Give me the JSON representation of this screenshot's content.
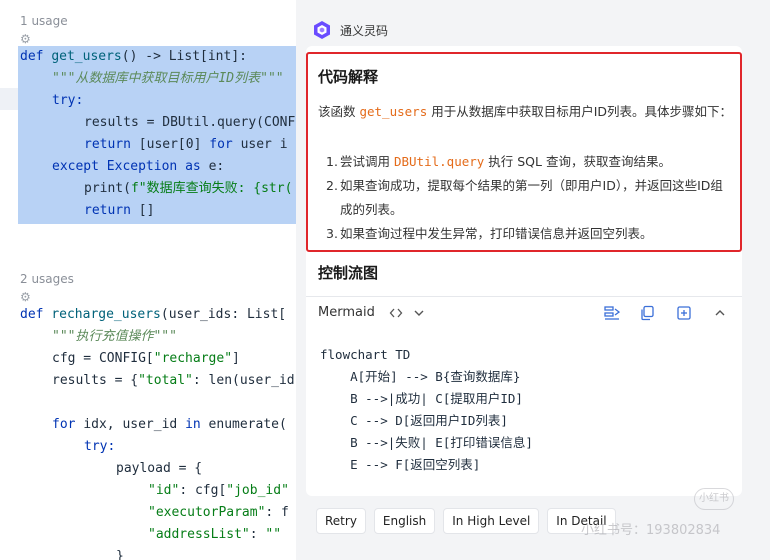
{
  "editor": {
    "usage_1": "1 usage",
    "usage_2": "2 usages",
    "lines": {
      "l1_def": "def ",
      "l1_fn": "get_users",
      "l1_rest": "() -> List[int]:",
      "l2_doc": "\"\"\"从数据库中获取目标用户ID列表\"\"\"",
      "l3_try": "try:",
      "l4": "results = DBUtil.query(CONF",
      "l5_return": "return ",
      "l5_rest": "[user[0] ",
      "l5_for": "for ",
      "l5_rest2": "user i",
      "l6_except": "except ",
      "l6_exc": "Exception ",
      "l6_as": "as ",
      "l6_rest": "e:",
      "l7_print": "print(",
      "l7_str": "f\"数据库查询失败: {str(",
      "l8_return": "return ",
      "l8_rest": "[]",
      "l9_def": "def ",
      "l9_fn": "recharge_users",
      "l9_rest": "(user_ids: List[",
      "l10_doc": "\"\"\"执行充值操作\"\"\"",
      "l11_a": "cfg = CONFIG[",
      "l11_str": "\"recharge\"",
      "l11_b": "]",
      "l12_a": "results = {",
      "l12_str": "\"total\"",
      "l12_b": ": len(user_id",
      "l13_for": "for ",
      "l13_a": "idx, user_id ",
      "l13_in": "in ",
      "l13_b": "enumerate(",
      "l14_try": "try:",
      "l15": "payload = {",
      "l16_str": "\"id\"",
      "l16_a": ": cfg[",
      "l16_str2": "\"job_id\"",
      "l17_str": "\"executorParam\"",
      "l17_a": ": f",
      "l18_str": "\"addressList\"",
      "l18_a": ": ",
      "l18_str2": "\"\"",
      "l19": "}"
    }
  },
  "panel": {
    "title": "通义灵码",
    "explain_title": "代码解释",
    "intro_a": "该函数 ",
    "intro_code": "get_users",
    "intro_b": " 用于从数据库中获取目标用户ID列表。具体步骤如下：",
    "steps": [
      {
        "num": "1.",
        "a": "尝试调用 ",
        "code": "DBUtil.query",
        "b": " 执行 SQL 查询，获取查询结果。"
      },
      {
        "num": "2.",
        "a": "如果查询成功，提取每个结果的第一列（即用户ID），并返回这些ID组成的列表。",
        "code": "",
        "b": ""
      },
      {
        "num": "3.",
        "a": "如果查询过程中发生异常，打印错误信息并返回空列表。",
        "code": "",
        "b": ""
      }
    ],
    "flow_title": "控制流图",
    "code_lang": "Mermaid",
    "mermaid": "flowchart TD\n    A[开始] --> B{查询数据库}\n    B -->|成功| C[提取用户ID]\n    C --> D[返回用户ID列表]\n    B -->|失败| E[打印错误信息]\n    E --> F[返回空列表]",
    "actions": [
      "Retry",
      "English",
      "In High Level",
      "In Detail"
    ],
    "watermark": "小红书号：193802834",
    "watermark_badge": "小红书"
  },
  "colors": {
    "highlight_border": "#e0262b",
    "selection": "#b8d2f5",
    "inline_code": "#e46b1a",
    "keyword": "#0033b3"
  }
}
